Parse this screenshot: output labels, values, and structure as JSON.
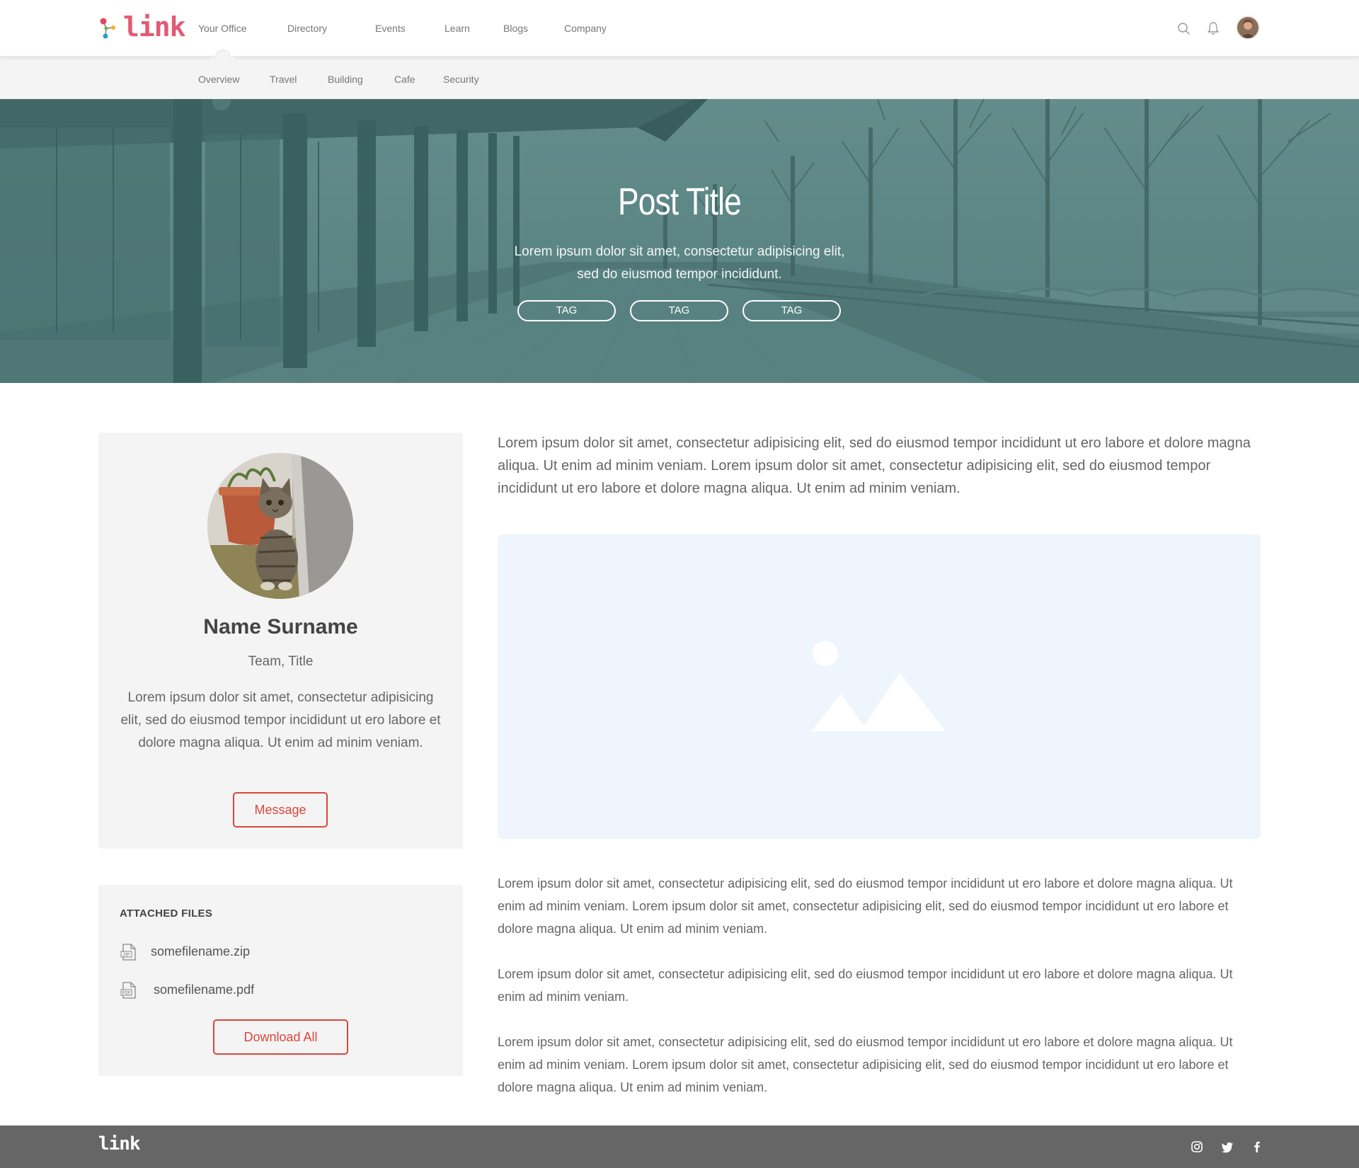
{
  "brand": {
    "name": "link",
    "accent": "#e35a73",
    "button_color": "#d9473b",
    "hero_tint": "#4e7977"
  },
  "topnav": {
    "items": [
      "Your Office",
      "Directory",
      "Events",
      "Learn",
      "Blogs",
      "Company"
    ],
    "active": "Your Office",
    "icons": [
      "search-icon",
      "bell-icon"
    ]
  },
  "subnav": {
    "items": [
      "Overview",
      "Travel",
      "Building",
      "Cafe",
      "Security"
    ],
    "active": "Overview"
  },
  "hero": {
    "title": "Post Title",
    "subtitle": "Lorem ipsum dolor sit amet, consectetur adipisicing elit, sed do eiusmod tempor incididunt.",
    "tags": [
      "TAG",
      "TAG",
      "TAG"
    ]
  },
  "profile": {
    "name": "Name Surname",
    "role": "Team, Title",
    "bio": "Lorem ipsum dolor sit amet, consectetur adipisicing elit, sed do eiusmod tempor incididunt ut ero labore et dolore magna aliqua. Ut enim ad minim veniam.",
    "message_label": "Message"
  },
  "files": {
    "heading": "ATTACHED FILES",
    "items": [
      {
        "name": "somefilename.zip",
        "icon": "zip-file-icon",
        "ext": "ZIP"
      },
      {
        "name": "somefilename.pdf",
        "icon": "pdf-file-icon",
        "ext": "PDF"
      }
    ],
    "download_label": "Download All"
  },
  "content": {
    "lead": "Lorem ipsum dolor sit amet, consectetur adipisicing elit, sed do eiusmod tempor incididunt ut ero labore et dolore magna aliqua. Ut enim ad minim veniam. Lorem ipsum dolor sit amet, consectetur adipisicing elit, sed do eiusmod tempor incididunt ut ero labore et dolore magna aliqua. Ut enim ad minim veniam.",
    "paragraphs": [
      "Lorem ipsum dolor sit amet, consectetur adipisicing elit, sed do eiusmod tempor incididunt ut ero labore et dolore magna aliqua. Ut enim ad minim veniam. Lorem ipsum dolor sit amet, consectetur adipisicing elit, sed do eiusmod tempor incididunt ut ero labore et dolore magna aliqua. Ut enim ad minim veniam.",
      "Lorem ipsum dolor sit amet, consectetur adipisicing elit, sed do eiusmod tempor incididunt ut ero labore et dolore magna aliqua. Ut enim ad minim veniam.",
      "Lorem ipsum dolor sit amet, consectetur adipisicing elit, sed do eiusmod tempor incididunt ut ero labore et dolore magna aliqua. Ut enim ad minim veniam. Lorem ipsum dolor sit amet, consectetur adipisicing elit, sed do eiusmod tempor incididunt ut ero labore et dolore magna aliqua. Ut enim ad minim veniam."
    ],
    "image_icon": "image-placeholder-icon"
  },
  "footer": {
    "logo": "link",
    "social_icons": [
      "instagram-icon",
      "twitter-icon",
      "facebook-icon"
    ]
  }
}
